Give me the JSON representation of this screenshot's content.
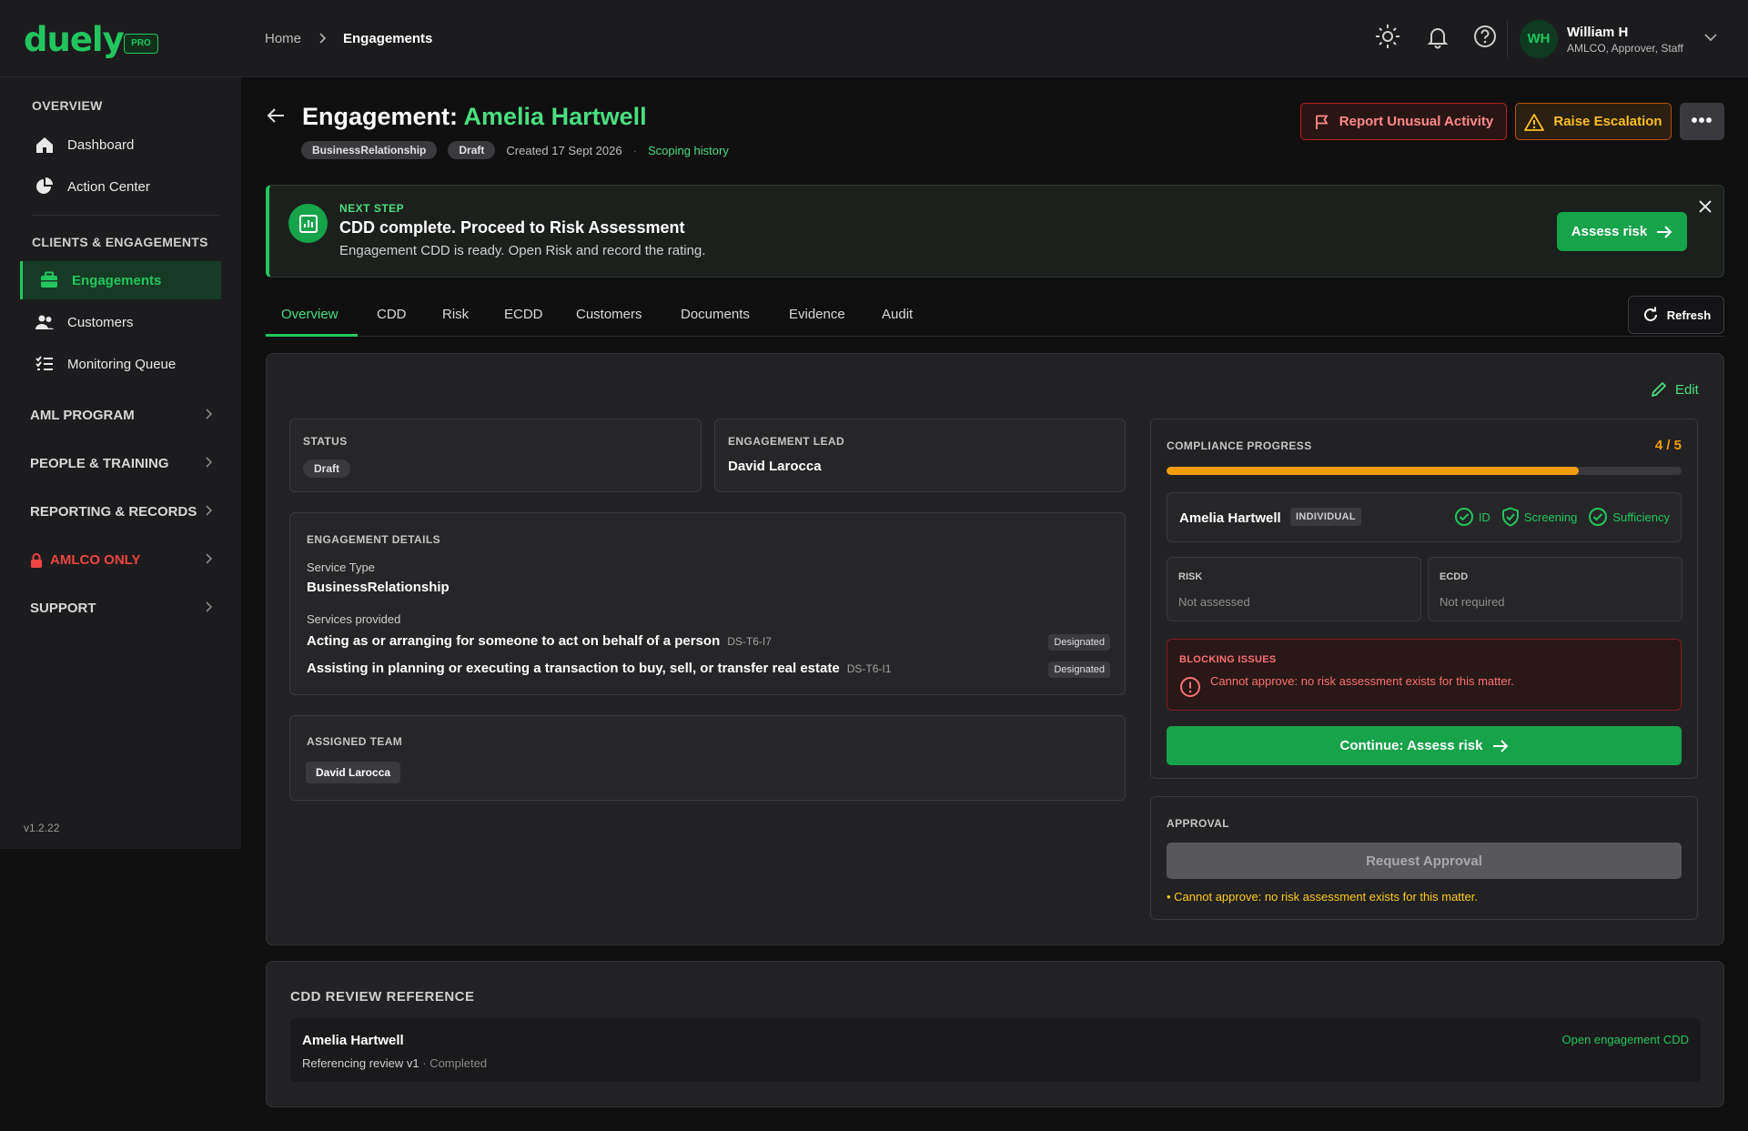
{
  "brand": {
    "logo": "duely",
    "badge": "PRO"
  },
  "breadcrumb": {
    "home": "Home",
    "current": "Engagements"
  },
  "user": {
    "initials": "WH",
    "name": "William H",
    "role": "AMLCO, Approver, Staff"
  },
  "sidebar": {
    "overview_heading": "OVERVIEW",
    "overview_items": [
      {
        "label": "Dashboard"
      },
      {
        "label": "Action Center"
      }
    ],
    "clients_heading": "CLIENTS & ENGAGEMENTS",
    "clients_items": [
      {
        "label": "Engagements"
      },
      {
        "label": "Customers"
      },
      {
        "label": "Monitoring Queue"
      }
    ],
    "groups": [
      {
        "label": "AML PROGRAM"
      },
      {
        "label": "PEOPLE & TRAINING"
      },
      {
        "label": "REPORTING & RECORDS"
      },
      {
        "label": "AMLCO ONLY"
      },
      {
        "label": "SUPPORT"
      }
    ],
    "version": "v1.2.22"
  },
  "header": {
    "title_prefix": "Engagement: ",
    "title_name": "Amelia Hartwell",
    "chip_type": "BusinessRelationship",
    "chip_status": "Draft",
    "created": "Created 17 Sept 2026",
    "separator": "·",
    "history_link": "Scoping history",
    "report_label": "Report Unusual Activity",
    "escalation_label": "Raise Escalation",
    "more_label": "•••"
  },
  "banner": {
    "kicker": "NEXT STEP",
    "title": "CDD complete. Proceed to Risk Assessment",
    "subtitle": "Engagement CDD is ready. Open Risk and record the rating.",
    "button": "Assess risk"
  },
  "tabs": [
    {
      "label": "Overview"
    },
    {
      "label": "CDD"
    },
    {
      "label": "Risk"
    },
    {
      "label": "ECDD"
    },
    {
      "label": "Customers"
    },
    {
      "label": "Documents"
    },
    {
      "label": "Evidence"
    },
    {
      "label": "Audit"
    }
  ],
  "refresh_label": "Refresh",
  "edit_label": "Edit",
  "status_card": {
    "label": "STATUS",
    "value": "Draft"
  },
  "lead_card": {
    "label": "ENGAGEMENT LEAD",
    "value": "David Larocca"
  },
  "details": {
    "label": "ENGAGEMENT DETAILS",
    "service_type_label": "Service Type",
    "service_type": "BusinessRelationship",
    "services_label": "Services provided",
    "services": [
      {
        "name": "Acting as or arranging for someone to act on behalf of a person",
        "code": "DS-T6-I7",
        "tag": "Designated"
      },
      {
        "name": "Assisting in planning or executing a transaction to buy, sell, or transfer real estate",
        "code": "DS-T6-I1",
        "tag": "Designated"
      }
    ]
  },
  "team": {
    "label": "ASSIGNED TEAM",
    "member": "David Larocca"
  },
  "compliance": {
    "label": "COMPLIANCE PROGRESS",
    "count": "4 / 5",
    "progress_fraction": 0.8,
    "customer": "Amelia Hartwell",
    "customer_type": "INDIVIDUAL",
    "checks": [
      {
        "label": "ID"
      },
      {
        "label": "Screening"
      },
      {
        "label": "Sufficiency"
      }
    ],
    "risk_label": "RISK",
    "risk_value": "Not assessed",
    "ecdd_label": "ECDD",
    "ecdd_value": "Not required",
    "blocking_label": "BLOCKING ISSUES",
    "blocking_message": "Cannot approve: no risk assessment exists for this matter.",
    "continue_label": "Continue: Assess risk"
  },
  "approval": {
    "label": "APPROVAL",
    "button": "Request Approval",
    "note": "• Cannot approve: no risk assessment exists for this matter."
  },
  "cdd_reference": {
    "title": "CDD REVIEW REFERENCE",
    "name": "Amelia Hartwell",
    "review": "Referencing review v1",
    "status": " · Completed",
    "link": "Open engagement CDD"
  },
  "colors": {
    "accent": "#22c55e",
    "warning": "#f59e0b",
    "danger": "#ef4444"
  }
}
